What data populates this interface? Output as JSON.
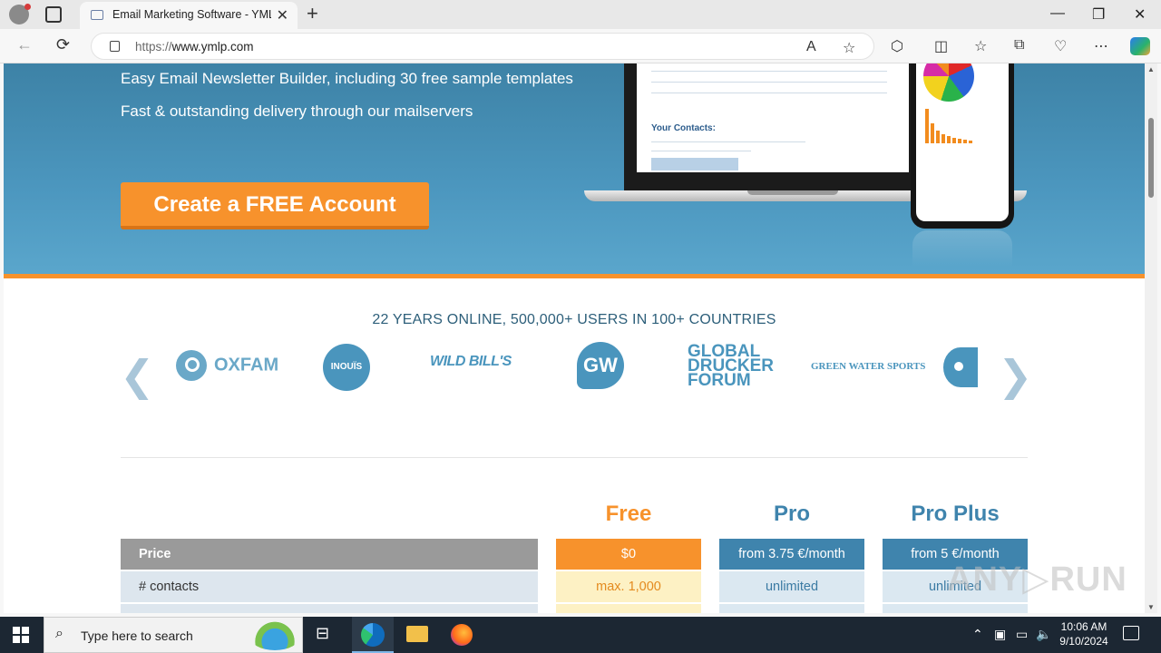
{
  "browser": {
    "tab_title": "Email Marketing Software - YMLP",
    "tab_close": "✕",
    "new_tab": "+",
    "url_scheme": "https://",
    "url_host": "www.ymlp.com",
    "window_controls": {
      "minimize": "—",
      "maximize": "❐",
      "close": "✕"
    },
    "nav": {
      "back": "←",
      "refresh": "⟳"
    }
  },
  "hero": {
    "line1": "Easy Email Newsletter Builder, including 30 free sample templates",
    "line2": "Fast & outstanding delivery through our mailservers",
    "cta_label": "Create a FREE Account",
    "laptop_heading": "Your Contacts:"
  },
  "clients": {
    "title": "22 YEARS ONLINE, 500,000+ USERS IN 100+ COUNTRIES",
    "prev_arrow": "❮",
    "next_arrow": "❯",
    "logos": {
      "oxfam": "OXFAM",
      "inouis": "INOUÏS",
      "wild_bills": "WILD BILL'S",
      "gw": "GW",
      "drucker": "GLOBAL\nDRUCKER\nFORUM",
      "green_water": "GREEN WATER SPORTS"
    }
  },
  "pricing": {
    "plans": [
      "Free",
      "Pro",
      "Pro Plus"
    ],
    "rows": {
      "price": {
        "label": "Price",
        "values": [
          "$0",
          "from 3.75 €/month",
          "from 5 €/month"
        ]
      },
      "contacts": {
        "label": "# contacts",
        "values": [
          "max. 1,000",
          "unlimited",
          "unlimited"
        ]
      }
    },
    "colors": {
      "free": "#f7922c",
      "pro": "#3f84ad"
    }
  },
  "watermark": "ANY▷RUN",
  "taskbar": {
    "search_placeholder": "Type here to search",
    "time": "10:06 AM",
    "date": "9/10/2024"
  }
}
